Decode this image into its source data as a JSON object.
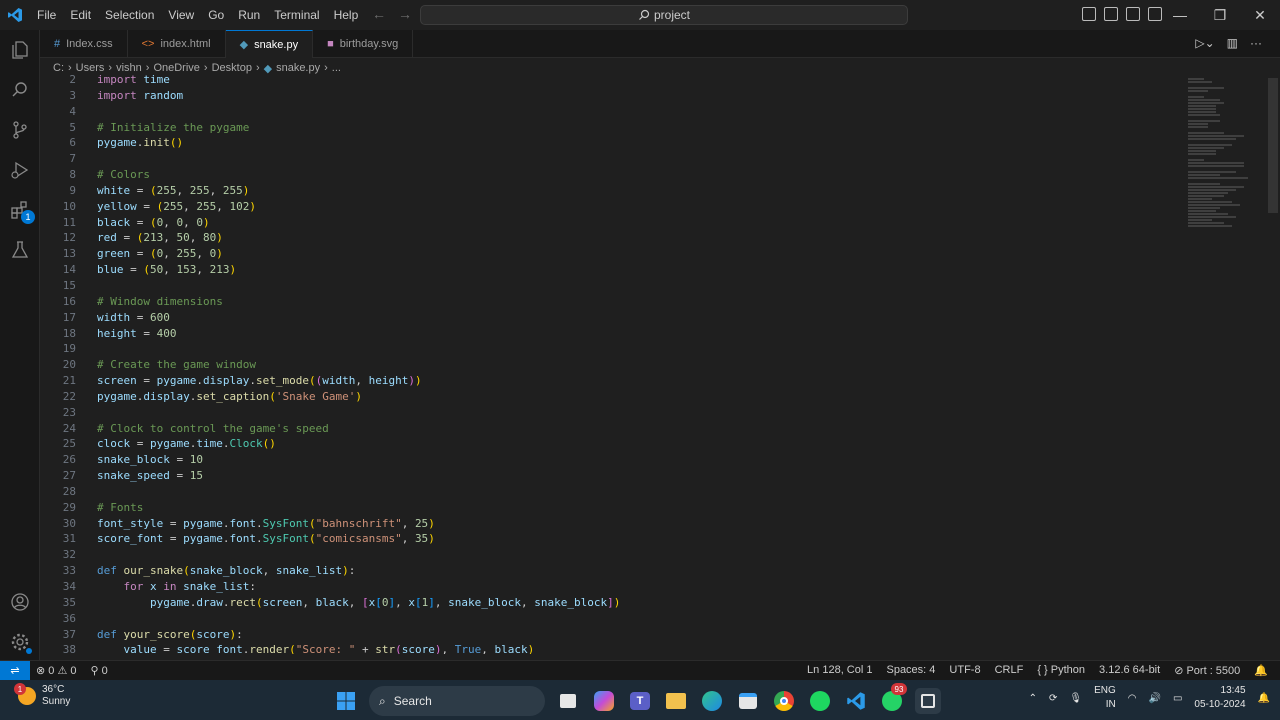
{
  "menu": [
    "File",
    "Edit",
    "Selection",
    "View",
    "Go",
    "Run",
    "Terminal",
    "Help"
  ],
  "search": {
    "label": "project"
  },
  "tabs": [
    {
      "label": "Index.css",
      "icon": "hash-icon",
      "color": "#569cd6"
    },
    {
      "label": "index.html",
      "icon": "html-icon",
      "color": "#e37933"
    },
    {
      "label": "snake.py",
      "icon": "python-icon",
      "color": "#519aba"
    },
    {
      "label": "birthday.svg",
      "icon": "svg-icon",
      "color": "#c586c0"
    }
  ],
  "breadcrumb": [
    "C:",
    "Users",
    "vishn",
    "OneDrive",
    "Desktop",
    "snake.py",
    "..."
  ],
  "code": [
    {
      "n": "2",
      "t": "import time"
    },
    {
      "n": "3",
      "t": "import random"
    },
    {
      "n": "4",
      "t": ""
    },
    {
      "n": "5",
      "t": "# Initialize the pygame"
    },
    {
      "n": "6",
      "t": "pygame.init()"
    },
    {
      "n": "7",
      "t": ""
    },
    {
      "n": "8",
      "t": "# Colors"
    },
    {
      "n": "9",
      "t": "white = (255, 255, 255)"
    },
    {
      "n": "10",
      "t": "yellow = (255, 255, 102)"
    },
    {
      "n": "11",
      "t": "black = (0, 0, 0)"
    },
    {
      "n": "12",
      "t": "red = (213, 50, 80)"
    },
    {
      "n": "13",
      "t": "green = (0, 255, 0)"
    },
    {
      "n": "14",
      "t": "blue = (50, 153, 213)"
    },
    {
      "n": "15",
      "t": ""
    },
    {
      "n": "16",
      "t": "# Window dimensions"
    },
    {
      "n": "17",
      "t": "width = 600"
    },
    {
      "n": "18",
      "t": "height = 400"
    },
    {
      "n": "19",
      "t": ""
    },
    {
      "n": "20",
      "t": "# Create the game window"
    },
    {
      "n": "21",
      "t": "screen = pygame.display.set_mode((width, height))"
    },
    {
      "n": "22",
      "t": "pygame.display.set_caption('Snake Game')"
    },
    {
      "n": "23",
      "t": ""
    },
    {
      "n": "24",
      "t": "# Clock to control the game's speed"
    },
    {
      "n": "25",
      "t": "clock = pygame.time.Clock()"
    },
    {
      "n": "26",
      "t": "snake_block = 10"
    },
    {
      "n": "27",
      "t": "snake_speed = 15"
    },
    {
      "n": "28",
      "t": ""
    },
    {
      "n": "29",
      "t": "# Fonts"
    },
    {
      "n": "30",
      "t": "font_style = pygame.font.SysFont(\"bahnschrift\", 25)"
    },
    {
      "n": "31",
      "t": "score_font = pygame.font.SysFont(\"comicsansms\", 35)"
    },
    {
      "n": "32",
      "t": ""
    },
    {
      "n": "33",
      "t": "def our_snake(snake_block, snake_list):"
    },
    {
      "n": "34",
      "t": "    for x in snake_list:"
    },
    {
      "n": "35",
      "t": "        pygame.draw.rect(screen, black, [x[0], x[1], snake_block, snake_block])"
    },
    {
      "n": "36",
      "t": ""
    },
    {
      "n": "37",
      "t": "def your_score(score):"
    },
    {
      "n": "38",
      "t": "    value = score_font.render(\"Score: \" + str(score), True, black)"
    }
  ],
  "status": {
    "errors": "0",
    "warnings": "0",
    "ports_count": "0",
    "position": "Ln 128, Col 1",
    "spaces": "Spaces: 4",
    "encoding": "UTF-8",
    "eol": "CRLF",
    "language": "Python",
    "interpreter": "3.12.6 64-bit",
    "port": "Port : 5500"
  },
  "taskbar": {
    "temp": "36°C",
    "weather": "Sunny",
    "weather_badge": "1",
    "search": "Search",
    "whatsapp_badge": "93",
    "lang1": "ENG",
    "lang2": "IN",
    "time": "13:45",
    "date": "05-10-2024"
  },
  "extensions_badge": "1"
}
